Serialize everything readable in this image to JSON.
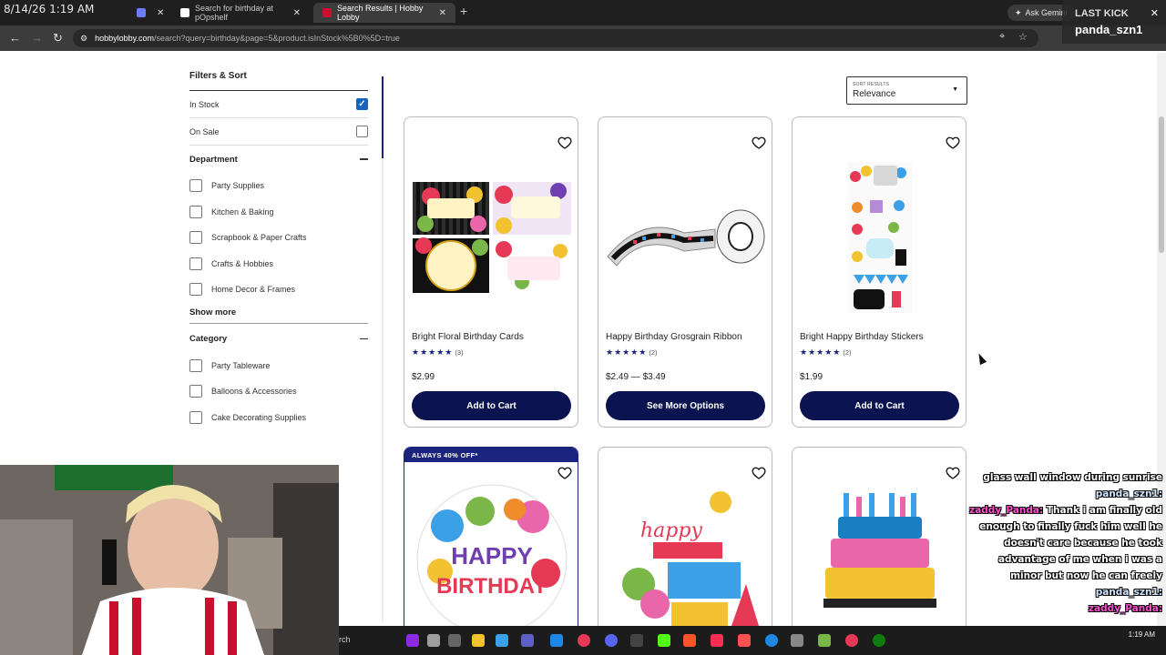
{
  "overlay_clock": "8/14/26 1:19 AM",
  "tabs": [
    {
      "title": "",
      "icon": "extension-icon",
      "active": false
    },
    {
      "title": "Search for birthday at pOpshelf",
      "icon": "popshelf-favicon",
      "active": false
    },
    {
      "title": "Search Results | Hobby Lobby",
      "icon": "hobbylobby-favicon",
      "active": true
    }
  ],
  "gemini_label": "Ask Gemini",
  "url": {
    "host": "hobbylobby.com",
    "rest": "/search?query=birthday&page=5&product.isInStock%5B0%5D=true"
  },
  "last_kick": {
    "label": "LAST KICK",
    "name": "panda_szn1"
  },
  "filters": {
    "title": "Filters & Sort",
    "toggles": [
      {
        "label": "In Stock",
        "checked": true
      },
      {
        "label": "On Sale",
        "checked": false
      }
    ],
    "department": {
      "title": "Department",
      "options": [
        "Party Supplies",
        "Kitchen & Baking",
        "Scrapbook & Paper Crafts",
        "Crafts & Hobbies",
        "Home Decor & Frames"
      ],
      "show_more": "Show more"
    },
    "category": {
      "title": "Category",
      "options": [
        "Party Tableware",
        "Balloons & Accessories",
        "Cake Decorating Supplies"
      ]
    }
  },
  "sort": {
    "label": "SORT RESULTS",
    "value": "Relevance"
  },
  "products": [
    {
      "name": "Bright Floral Birthday Cards",
      "stars": 5,
      "reviews": "(3)",
      "price": "$2.99",
      "button": "Add to Cart",
      "image": "floral-cards"
    },
    {
      "name": "Happy Birthday Grosgrain Ribbon",
      "stars": 5,
      "reviews": "(2)",
      "price": "$2.49 — $3.49",
      "button": "See More Options",
      "image": "ribbon"
    },
    {
      "name": "Bright Happy Birthday Stickers",
      "stars": 5,
      "reviews": "(2)",
      "price": "$1.99",
      "button": "Add to Cart",
      "image": "stickers"
    },
    {
      "badge": "ALWAYS 40% OFF*",
      "image": "happy-birthday-plate"
    },
    {
      "image": "birthday-cutouts"
    },
    {
      "image": "cake-decor"
    }
  ],
  "chat": [
    {
      "text": "glass wall window during sunrise"
    },
    {
      "user": "panda_szn1:",
      "text": ""
    },
    {
      "user": "zaddy_Panda:",
      "text": "Thank i am finally old enough to finally fuck him well he doesn't care because he took advantage of me when i was a minor but now he can freely"
    },
    {
      "user": "panda_szn1:",
      "text": ""
    },
    {
      "user": "zaddy_Panda:",
      "text": ""
    }
  ],
  "taskbar": {
    "search": "rch",
    "time": "1:19 AM"
  },
  "colors": {
    "accent_navy": "#0b1450",
    "checkbox_blue": "#1565c0",
    "brand_red": "#c8102e"
  }
}
